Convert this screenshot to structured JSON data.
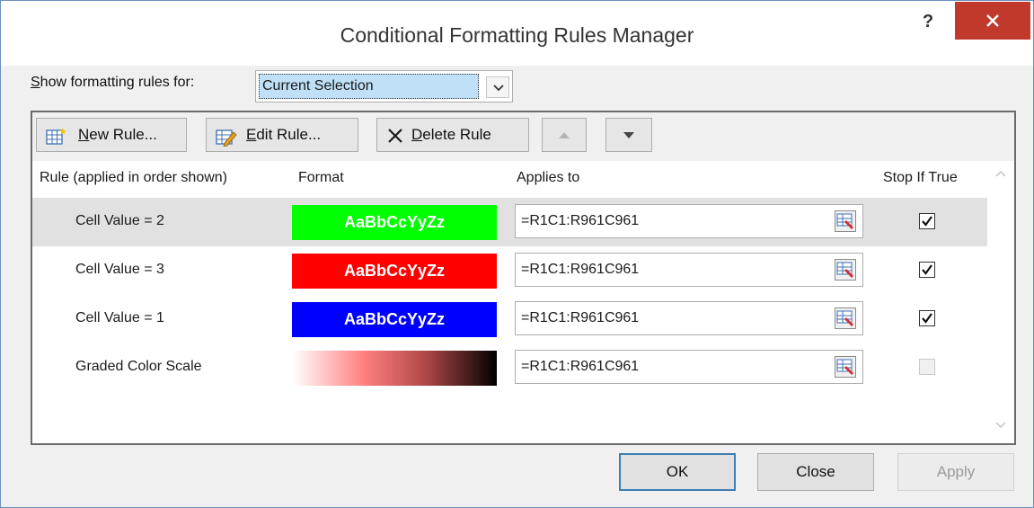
{
  "window": {
    "title": "Conditional Formatting Rules Manager",
    "help_label": "?"
  },
  "scope": {
    "label_prefix": "S",
    "label_rest": "how formatting rules for:",
    "selected": "Current Selection"
  },
  "toolbar": {
    "new_rule_mn": "N",
    "new_rule_rest": "ew Rule...",
    "edit_rule_mn": "E",
    "edit_rule_rest": "dit Rule...",
    "delete_rule_mn": "D",
    "delete_rule_rest": "elete Rule"
  },
  "columns": {
    "rule": "Rule (applied in order shown)",
    "format": "Format",
    "applies_to": "Applies to",
    "stop_if_true": "Stop If True"
  },
  "rules": [
    {
      "name": "Cell Value = 2",
      "preview": "AaBbCcYyZz",
      "color": "#00ff00",
      "applies_to": "=R1C1:R961C961",
      "stop_if_true": true
    },
    {
      "name": "Cell Value = 3",
      "preview": "AaBbCcYyZz",
      "color": "#ff0000",
      "applies_to": "=R1C1:R961C961",
      "stop_if_true": true
    },
    {
      "name": "Cell Value = 1",
      "preview": "AaBbCcYyZz",
      "color": "#0000ff",
      "applies_to": "=R1C1:R961C961",
      "stop_if_true": true
    },
    {
      "name": "Graded Color Scale",
      "preview": "",
      "gradient_from": "#ffffff",
      "gradient_mid": "#ff6b6b",
      "gradient_to": "#000000",
      "applies_to": "=R1C1:R961C961",
      "stop_if_true": false
    }
  ],
  "buttons": {
    "ok": "OK",
    "close": "Close",
    "apply": "Apply"
  },
  "colors": {
    "accent": "#3c7fb1",
    "close_button": "#c0392b",
    "selection": "#bfe0f7"
  }
}
